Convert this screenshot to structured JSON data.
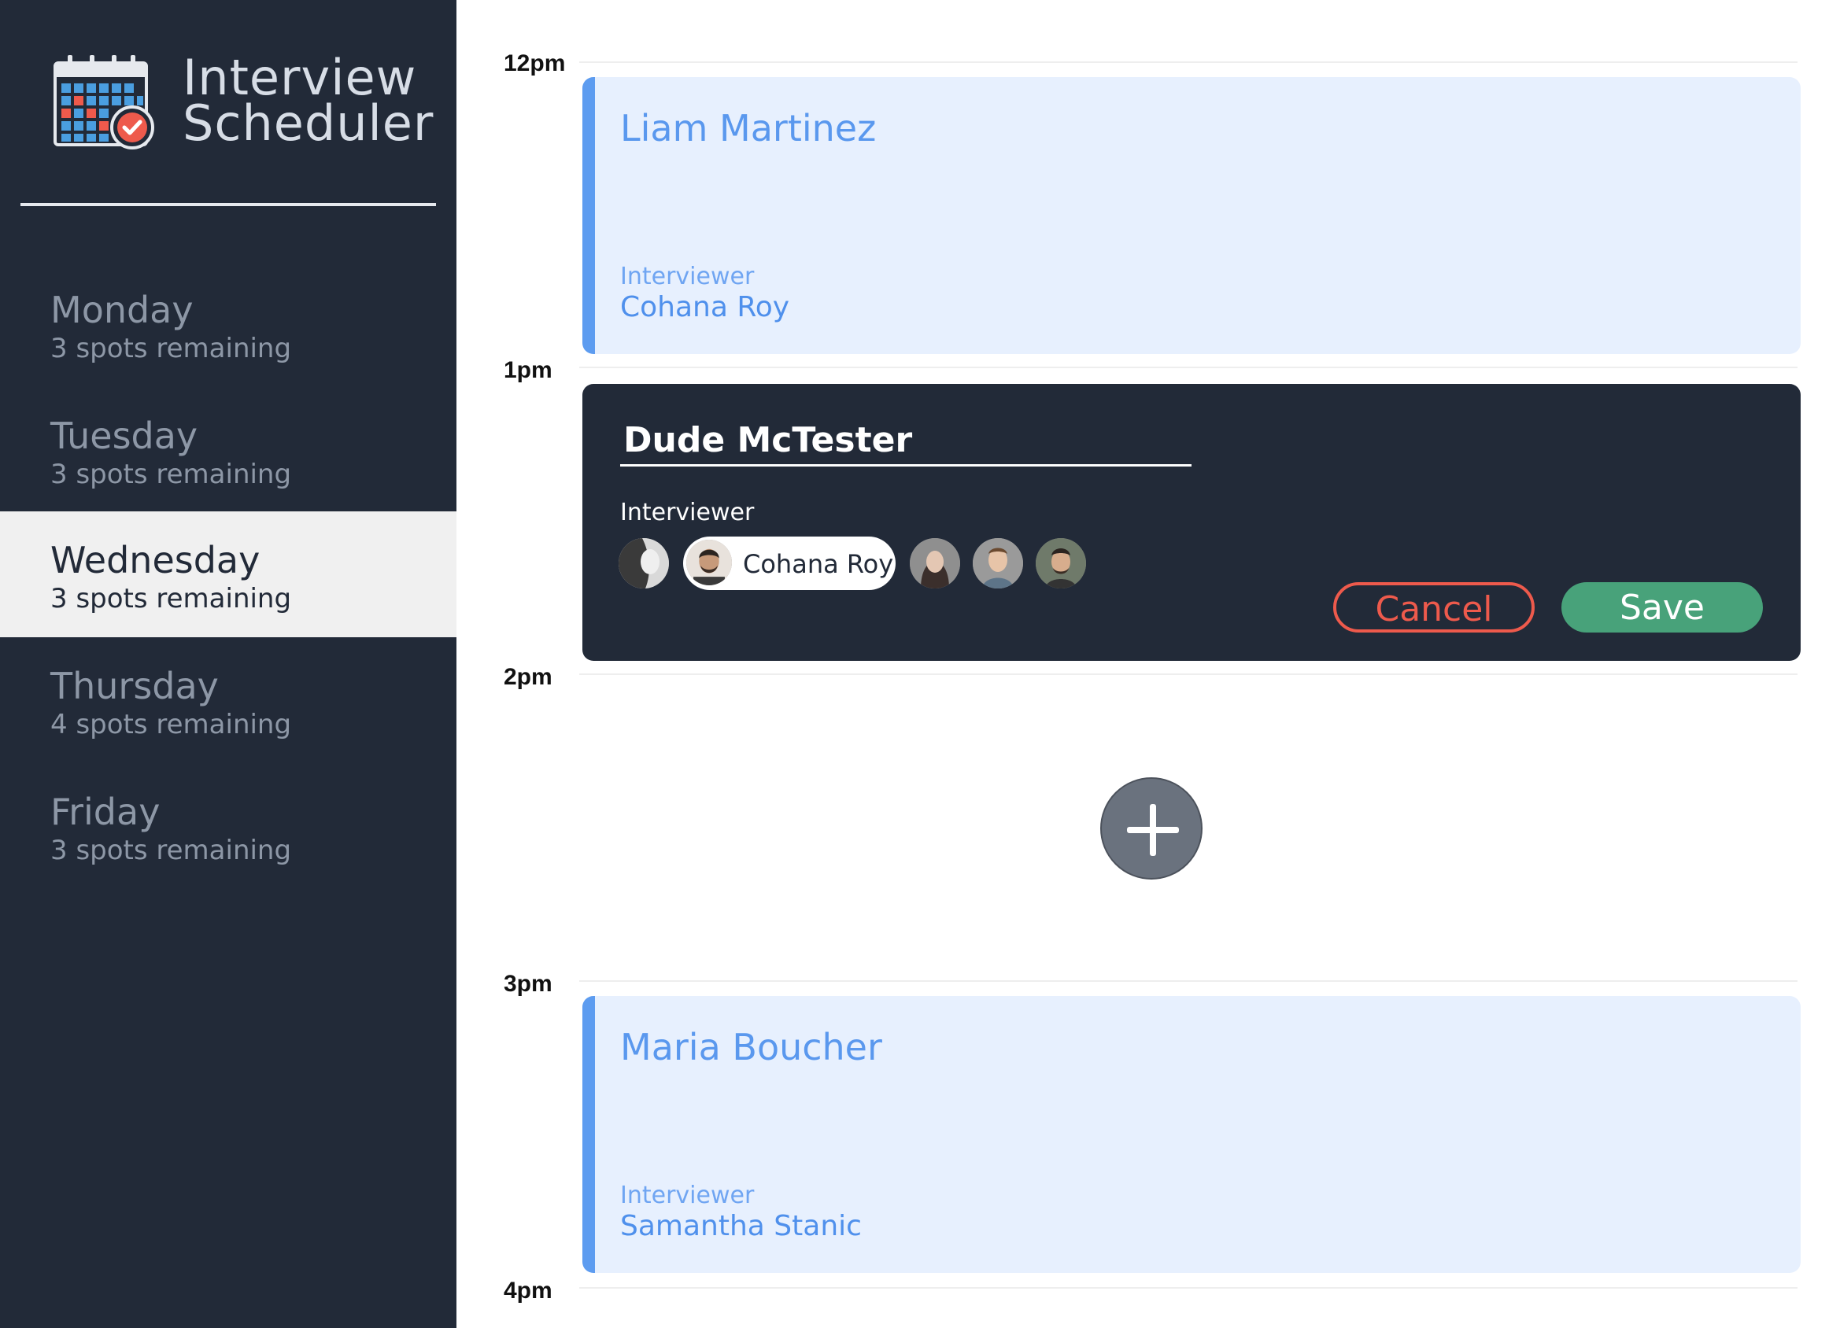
{
  "app": {
    "title_line1": "Interview",
    "title_line2": "Scheduler",
    "logo_icon": "calendar-check-icon"
  },
  "sidebar": {
    "days": [
      {
        "name": "Monday",
        "spots": "3 spots remaining",
        "selected": false
      },
      {
        "name": "Tuesday",
        "spots": "3 spots remaining",
        "selected": false
      },
      {
        "name": "Wednesday",
        "spots": "3 spots remaining",
        "selected": true
      },
      {
        "name": "Thursday",
        "spots": "4 spots remaining",
        "selected": false
      },
      {
        "name": "Friday",
        "spots": "3 spots remaining",
        "selected": false
      }
    ]
  },
  "schedule": {
    "hours": [
      "12pm",
      "1pm",
      "2pm",
      "3pm",
      "4pm"
    ],
    "appointments": [
      {
        "student": "Liam Martinez",
        "interviewer_label": "Interviewer",
        "interviewer": "Cohana Roy"
      },
      {
        "student": "Maria Boucher",
        "interviewer_label": "Interviewer",
        "interviewer": "Samantha Stanic"
      }
    ],
    "editor": {
      "student_value": "Dude McTester",
      "interviewer_label": "Interviewer",
      "selected_interviewer": "Cohana Roy",
      "cancel_label": "Cancel",
      "save_label": "Save"
    },
    "add_icon": "plus-icon"
  },
  "colors": {
    "sidebar_bg": "#222a38",
    "appointment_bg": "#e7f0fe",
    "accent_blue": "#5d9cf0",
    "cancel_red": "#ee5a4c",
    "save_green": "#48a27a"
  }
}
